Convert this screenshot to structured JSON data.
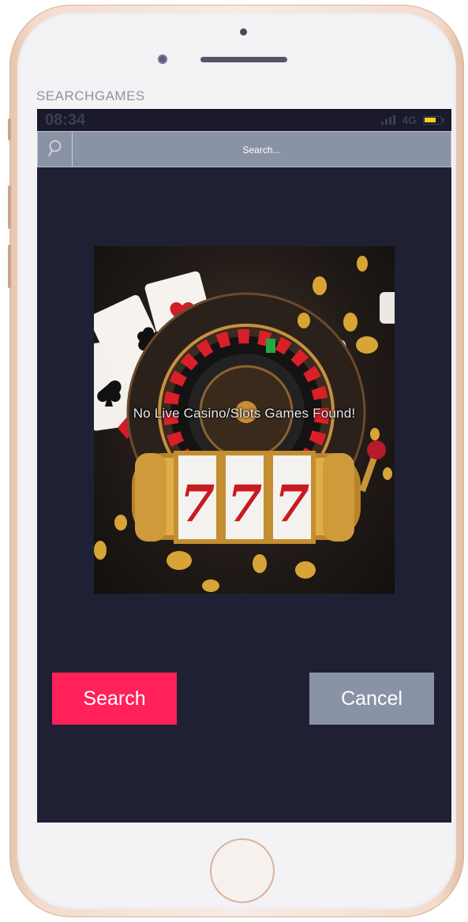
{
  "app": {
    "title": "SEARCHGAMES"
  },
  "status_bar": {
    "time": "08:34",
    "network": "4G",
    "battery_color": "#f2d01a"
  },
  "search": {
    "placeholder": "Search...",
    "icon": "search-icon"
  },
  "promo": {
    "image": "casino-slots-illustration",
    "reel_symbols": [
      "7",
      "7",
      "7"
    ],
    "message": "No Live Casino/Slots Games Found!"
  },
  "actions": {
    "search_label": "Search",
    "cancel_label": "Cancel",
    "search_color": "#ff2158",
    "cancel_color": "#8a93a6"
  },
  "theme": {
    "screen_background": "#1f2034",
    "search_bar_background": "#8a93a6"
  }
}
